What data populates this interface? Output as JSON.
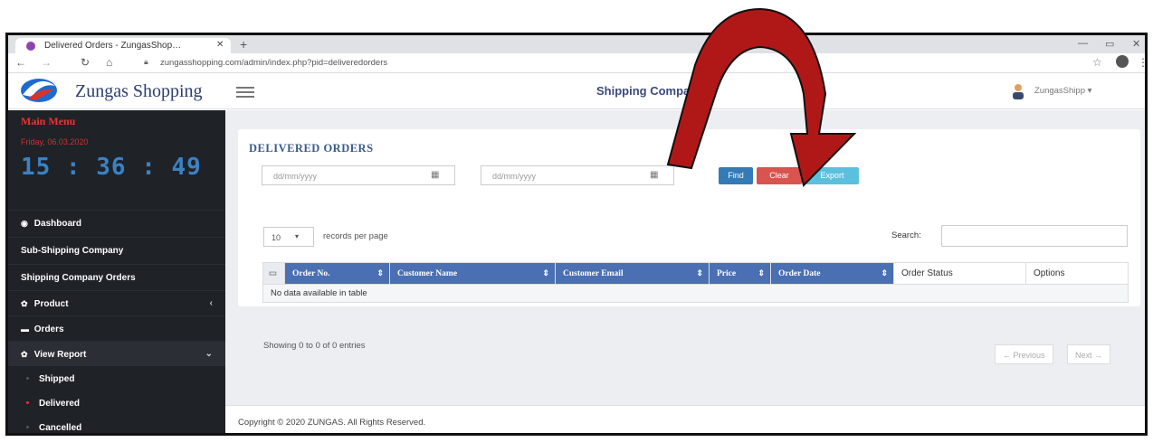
{
  "browser": {
    "tab_title": "Delivered Orders - ZungasShop…",
    "tab_close": "✕",
    "new_tab": "+",
    "url": "zungasshopping.com/admin/index.php?pid=deliveredorders",
    "win_min": "—",
    "win_max": "▭",
    "win_close": "✕"
  },
  "header": {
    "brand": "Zungas Shopping",
    "title": "Shipping Company",
    "user": "ZungasShipp ▾"
  },
  "sidebar": {
    "main_menu": "Main Menu",
    "date": "Friday, 06.03.2020",
    "clock": "15 : 36 : 49",
    "items": [
      {
        "label": "Dashboard",
        "icon": "dashboard-icon",
        "glyph": "◉"
      },
      {
        "label": "Sub-Shipping Company",
        "icon": "",
        "glyph": ""
      },
      {
        "label": "Shipping Company Orders",
        "icon": "",
        "glyph": ""
      },
      {
        "label": "Product",
        "icon": "gear-icon",
        "glyph": "✿",
        "caret": "‹"
      },
      {
        "label": "Orders",
        "icon": "cart-icon",
        "glyph": "▬"
      },
      {
        "label": "View Report",
        "icon": "gear-icon",
        "glyph": "✿",
        "caret": "⌄"
      }
    ],
    "subitems": [
      "Shipped",
      "Delivered",
      "Cancelled"
    ]
  },
  "content": {
    "title": "DELIVERED ORDERS",
    "date_from_placeholder": "dd/mm/yyyy",
    "date_to_placeholder": "dd/mm/yyyy",
    "find": "Find",
    "clear": "Clear",
    "export": "Export",
    "page_length": "10",
    "records_per_page": "records per page",
    "search_label": "Search:",
    "columns": [
      "Order No.",
      "Customer Name",
      "Customer Email",
      "Price",
      "Order Date",
      "Order Status",
      "Options"
    ],
    "empty": "No data available in table",
    "showing": "Showing 0 to 0 of 0 entries",
    "prev": "← Previous",
    "next": "Next →"
  },
  "footer": "Copyright © 2020 ZUNGAS. All Rights Reserved.",
  "colors": {
    "sidebar": "#1f2227",
    "primary": "#337ab7",
    "danger": "#d9534f",
    "info": "#5bc0de",
    "arrow": "#b01818"
  }
}
